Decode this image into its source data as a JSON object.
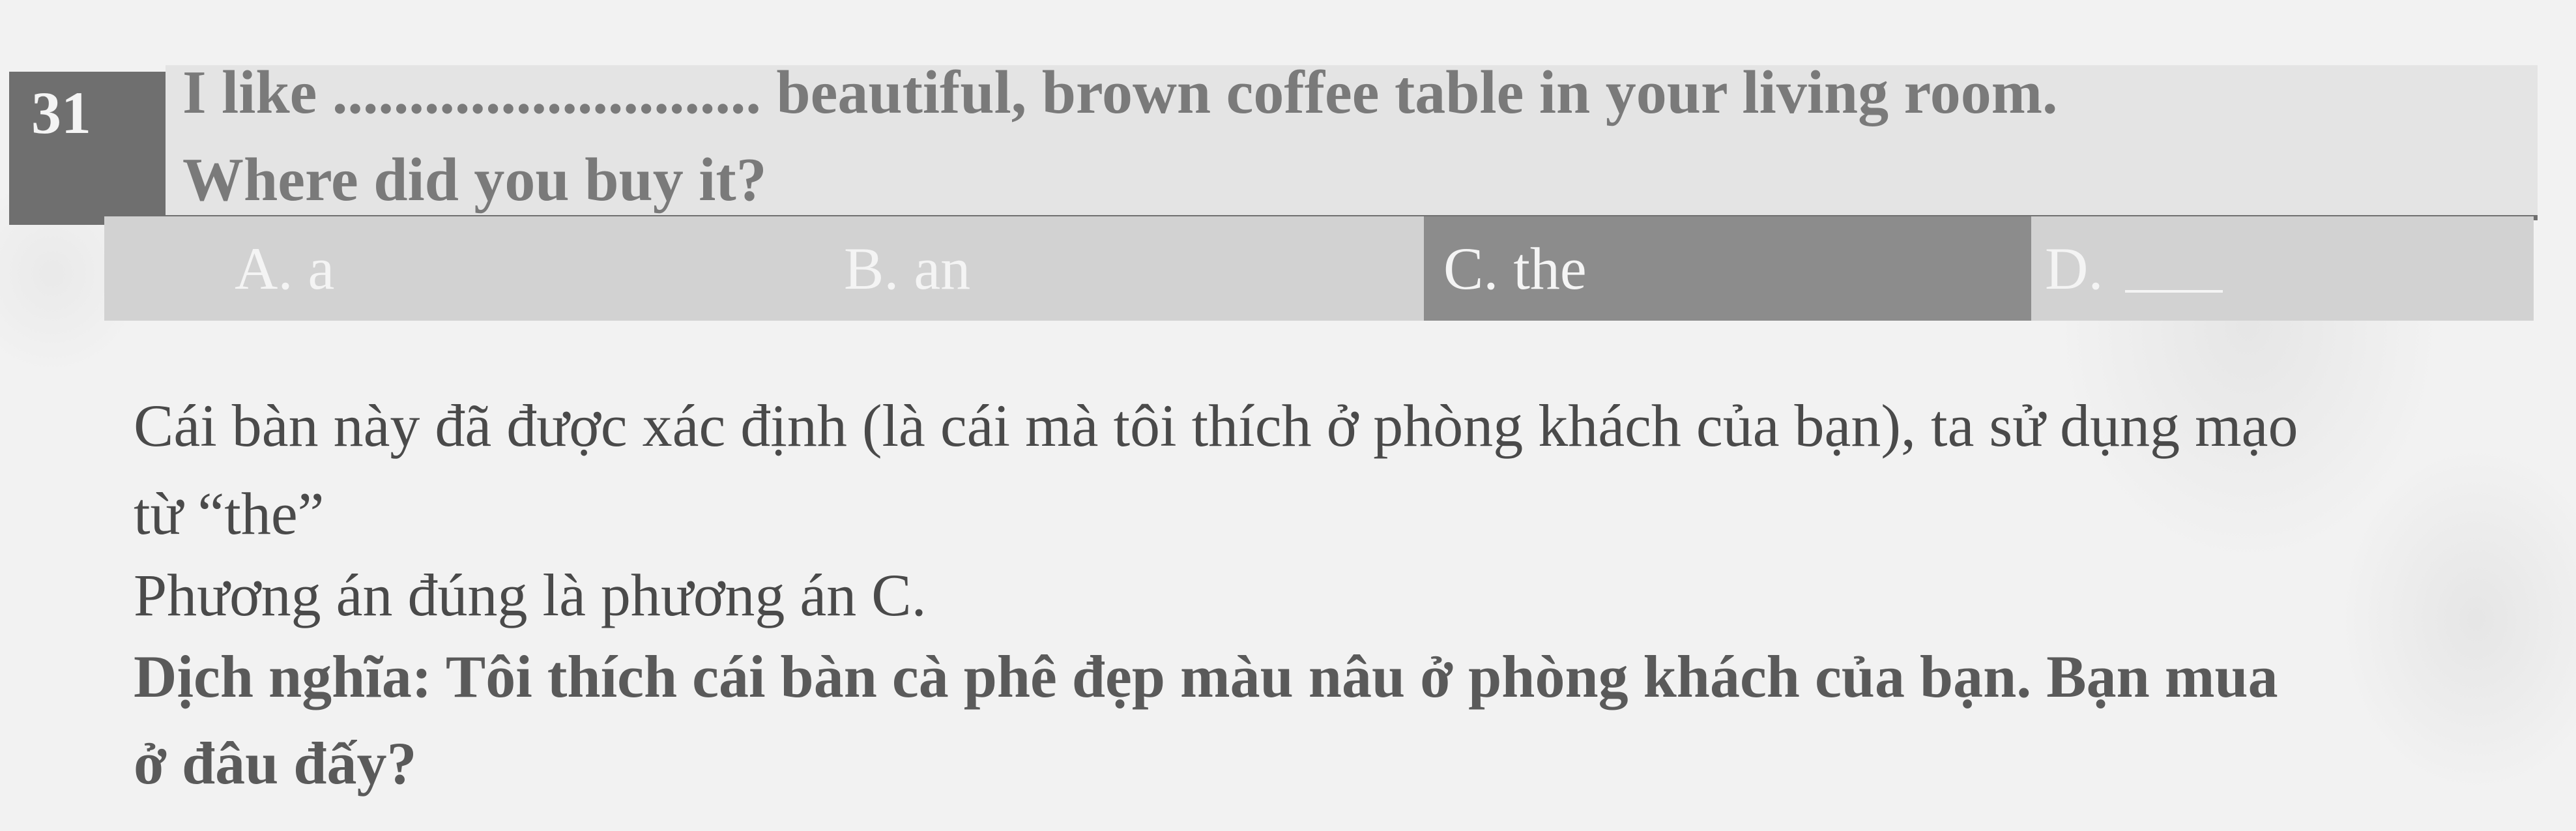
{
  "question": {
    "number": "31",
    "line1": "I like ............................ beautiful, brown coffee table in your living room.",
    "line2": "Where did you buy it?"
  },
  "options": {
    "a": "A. a",
    "b": "B. an",
    "c": "C. the",
    "d": "D."
  },
  "explanation": {
    "line1": "Cái bàn này đã được xác định (là cái mà tôi thích ở phòng khách của bạn), ta sử dụng mạo",
    "line2": "từ “the”",
    "line3": "Phương án đúng là phương án C."
  },
  "translation": {
    "line1": "Dịch nghĩa: Tôi thích cái bàn cà phê đẹp màu nâu ở phòng khách của bạn. Bạn mua",
    "line2": "ở đâu đấy?"
  },
  "colors": {
    "header_dark": "#6f6f6f",
    "header_light": "#e4e4e4",
    "options_bar": "#d2d2d2",
    "correct_option": "#8c8c8c",
    "text": "#4a4a4a"
  }
}
